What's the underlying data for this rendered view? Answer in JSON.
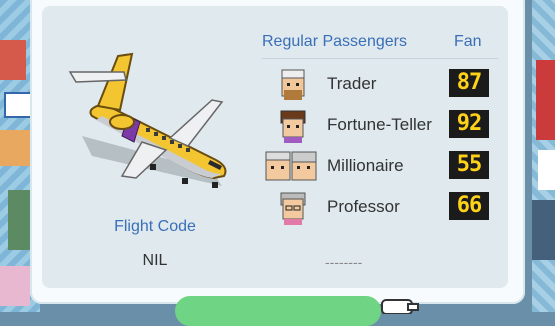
{
  "flight": {
    "code_label": "Flight Code",
    "code_value": "NIL"
  },
  "passengers_panel": {
    "header_label": "Regular Passengers",
    "fan_label": "Fan",
    "rows": [
      {
        "name": "Trader",
        "fan": "87"
      },
      {
        "name": "Fortune-Teller",
        "fan": "92"
      },
      {
        "name": "Millionaire",
        "fan": "55"
      },
      {
        "name": "Professor",
        "fan": "66"
      }
    ],
    "empty_slot": "--------"
  },
  "colors": {
    "accent_blue": "#3a6fb8",
    "fan_digits": "#ffd21a",
    "button_green": "#6fd585",
    "plane_yellow": "#f2c531"
  },
  "icons": [
    "airplane-icon",
    "pointing-hand-icon"
  ]
}
